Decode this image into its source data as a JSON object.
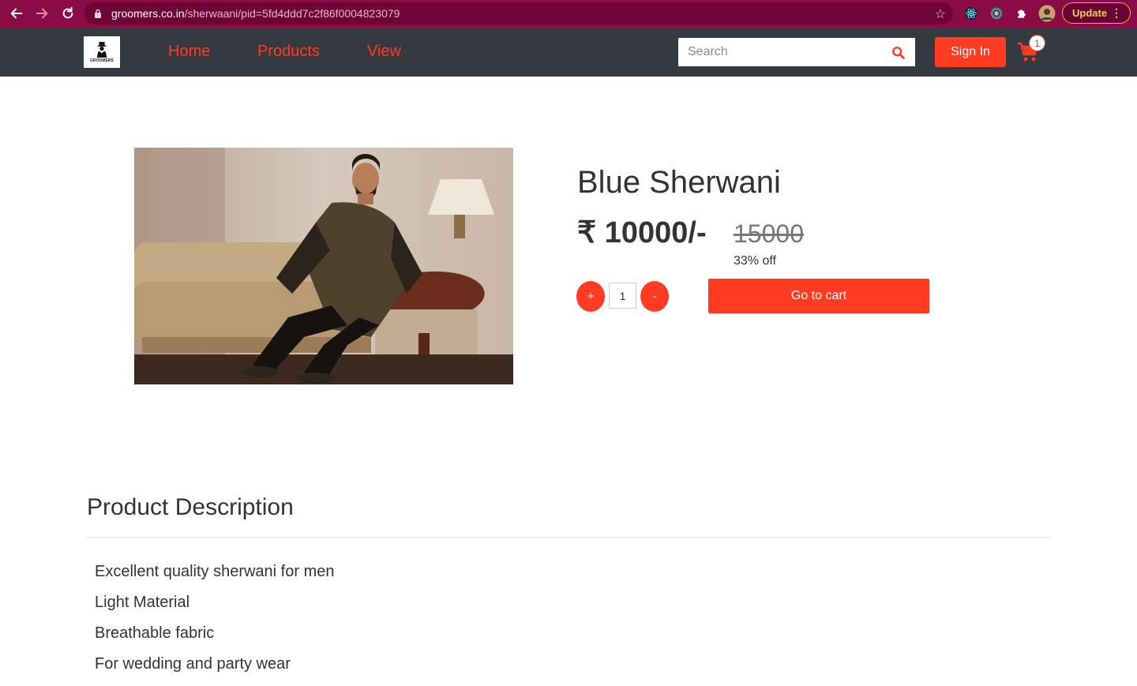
{
  "browser": {
    "url_host": "groomers.co.in",
    "url_path": "/sherwaani/pid=5fd4ddd7c2f86f0004823079",
    "update_label": "Update"
  },
  "navbar": {
    "logo_text": "GROOMERS",
    "links": [
      "Home",
      "Products",
      "View"
    ],
    "search_placeholder": "Search",
    "signin_label": "Sign In",
    "cart_count": "1"
  },
  "product": {
    "title": "Blue Sherwani",
    "price": "₹ 10000/-",
    "mrp": "15000",
    "discount": "33% off",
    "qty_plus": "+",
    "qty_value": "1",
    "qty_minus": "-",
    "go_to_cart_label": "Go to cart"
  },
  "description": {
    "title": "Product Description",
    "items": [
      "Excellent quality sherwani for men",
      "Light Material",
      "Breathable fabric",
      "For wedding and party wear"
    ]
  },
  "colors": {
    "accent": "#ff3b22",
    "navbar_bg": "#343a40",
    "browser_bar": "#8b0b45"
  }
}
